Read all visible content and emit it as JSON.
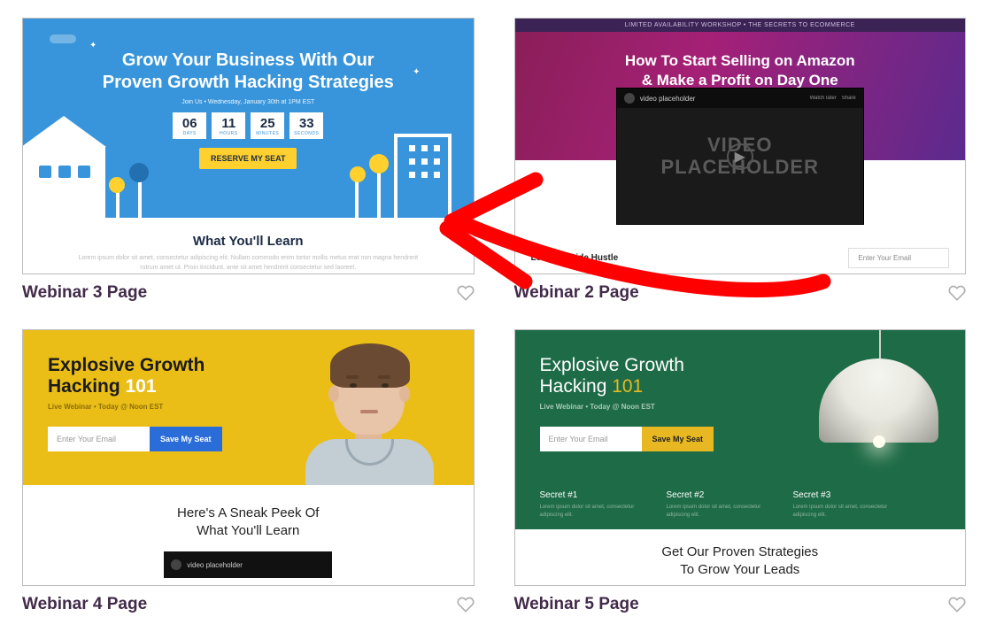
{
  "cards": [
    {
      "title": "Webinar 3 Page",
      "hero_title_l1": "Grow Your Business With Our",
      "hero_title_l2": "Proven Growth Hacking Strategies",
      "hero_sub": "Join Us • Wednesday, January 30th at 1PM EST",
      "timer": [
        {
          "num": "06",
          "lab": "DAYS"
        },
        {
          "num": "11",
          "lab": "HOURS"
        },
        {
          "num": "25",
          "lab": "MINUTES"
        },
        {
          "num": "33",
          "lab": "SECONDS"
        }
      ],
      "cta": "RESERVE MY SEAT",
      "band_h": "What You'll Learn",
      "band_p": "Lorem ipsum dolor sit amet, consectetur adipiscing elit. Nullam commodo enim tortor mollis metus erat non magna hendrerit rutrum amet ut. Proin tincidunt, ante sit amet hendrerit consectetur sed laoreet."
    },
    {
      "title": "Webinar 2 Page",
      "bar": "LIMITED AVAILABILITY WORKSHOP • THE SECRETS TO ECOMMERCE",
      "hero_l1": "How To Start Selling on Amazon",
      "hero_l2": "& Make a Profit on Day One",
      "video_label": "video placeholder",
      "video_a": "Watch later",
      "video_b": "Share",
      "video_txt_l1": "VIDEO",
      "video_txt_l2": "PLACEHOLDER",
      "foot_h": "Learn To Side Hustle",
      "foot_ph": "Enter Your Email"
    },
    {
      "title": "Webinar 4 Page",
      "h_l1": "Explosive Growth",
      "h_l2a": "Hacking ",
      "h_l2b": "101",
      "sub": "Live Webinar • Today @ Noon EST",
      "input_ph": "Enter Your Email",
      "btn": "Save My Seat",
      "band_l1": "Here's A Sneak Peek Of",
      "band_l2": "What You'll Learn",
      "vid_label": "video placeholder"
    },
    {
      "title": "Webinar 5 Page",
      "h_l1": "Explosive Growth",
      "h_l2a": "Hacking ",
      "h_l2b": "101",
      "sub": "Live Webinar • Today @ Noon EST",
      "input_ph": "Enter Your Email",
      "btn": "Save My Seat",
      "secrets": [
        {
          "h": "Secret #1",
          "p": "Lorem ipsum dolor sit amet, consectetur adipiscing elit."
        },
        {
          "h": "Secret #2",
          "p": "Lorem ipsum dolor sit amet, consectetur adipiscing elit."
        },
        {
          "h": "Secret #3",
          "p": "Lorem ipsum dolor sit amet, consectetur adipiscing elit."
        }
      ],
      "band_l1": "Get Our Proven Strategies",
      "band_l2": "To Grow Your Leads"
    }
  ]
}
